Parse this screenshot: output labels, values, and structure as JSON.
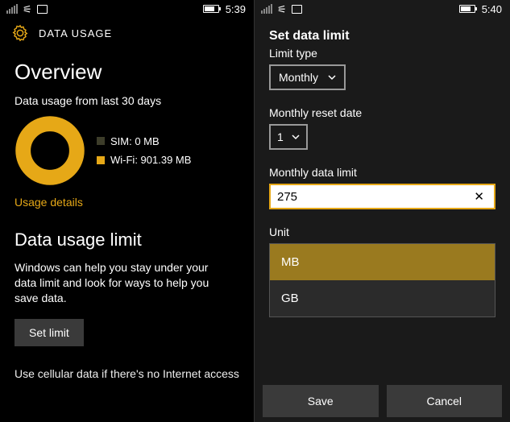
{
  "left": {
    "status": {
      "time": "5:39"
    },
    "header": {
      "title": "DATA USAGE"
    },
    "overview": {
      "heading": "Overview",
      "period": "Data usage from last 30 days",
      "legend": {
        "sim_label": "SIM: 0 MB",
        "wifi_label": "Wi-Fi: 901.39 MB"
      },
      "details_link": "Usage details"
    },
    "limit": {
      "heading": "Data usage limit",
      "desc": "Windows can help you stay under your data limit and look for ways to help you save data.",
      "set_button": "Set limit",
      "footnote": "Use cellular data if there's no Internet access"
    }
  },
  "right": {
    "status": {
      "time": "5:40"
    },
    "form": {
      "title": "Set data limit",
      "limit_type_label": "Limit type",
      "limit_type_value": "Monthly",
      "reset_label": "Monthly reset date",
      "reset_value": "1",
      "data_limit_label": "Monthly data limit",
      "data_limit_value": "275",
      "unit_label": "Unit",
      "unit_options": {
        "mb": "MB",
        "gb": "GB"
      }
    },
    "actions": {
      "save": "Save",
      "cancel": "Cancel"
    }
  },
  "colors": {
    "accent": "#e6a817"
  },
  "chart_data": {
    "type": "pie",
    "title": "Data usage from last 30 days",
    "series": [
      {
        "name": "SIM",
        "value": 0,
        "unit": "MB",
        "color": "#3d3d2a"
      },
      {
        "name": "Wi-Fi",
        "value": 901.39,
        "unit": "MB",
        "color": "#e6a817"
      }
    ]
  }
}
